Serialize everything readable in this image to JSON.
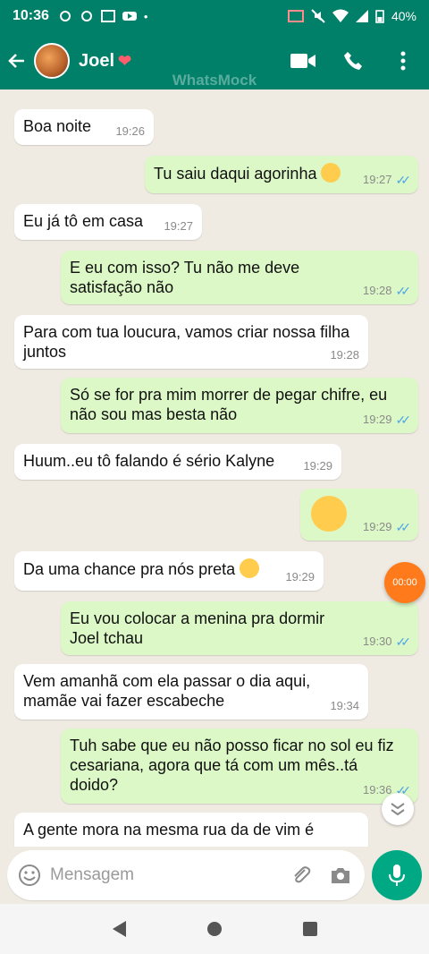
{
  "status_bar": {
    "time": "10:36",
    "battery": "40%"
  },
  "header": {
    "contact_name": "Joel",
    "watermark": "WhatsMock"
  },
  "messages": [
    {
      "dir": "in",
      "text": "Boa noite",
      "time": "19:26"
    },
    {
      "dir": "out",
      "text": "Tu saiu daqui agorinha",
      "time": "19:27"
    },
    {
      "dir": "in",
      "text": "Eu já tô em casa",
      "time": "19:27"
    },
    {
      "dir": "out",
      "text": "E eu com isso? Tu não me deve satisfação não",
      "time": "19:28"
    },
    {
      "dir": "in",
      "text": "Para com tua loucura, vamos criar nossa filha juntos",
      "time": "19:28"
    },
    {
      "dir": "out",
      "text": "Só se for pra mim morrer de pegar chifre, eu não sou mas besta não",
      "time": "19:29"
    },
    {
      "dir": "in",
      "text": "Huum..eu tô falando é sério Kalyne",
      "time": "19:29"
    },
    {
      "dir": "out",
      "text": "",
      "time": "19:29"
    },
    {
      "dir": "in",
      "text": "Da uma chance pra nós preta",
      "time": "19:29"
    },
    {
      "dir": "out",
      "text": "Eu vou colocar a menina pra dormir Joel tchau",
      "time": "19:30"
    },
    {
      "dir": "in",
      "text": "Vem amanhã com ela passar o dia aqui, mamãe vai fazer escabeche",
      "time": "19:34"
    },
    {
      "dir": "out",
      "text": "Tuh sabe que eu não posso ficar no sol eu fiz cesariana, agora que tá com um mês..tá doido?",
      "time": "19:36"
    },
    {
      "dir": "in",
      "text": "A gente mora na mesma rua da de vim é",
      "time": ""
    }
  ],
  "timer": "00:00",
  "composer": {
    "placeholder": "Mensagem"
  },
  "colors": {
    "header": "#008069",
    "outgoing": "#dcf8c6",
    "incoming": "#ffffff",
    "fab": "#00a884",
    "read_ticks": "#4fa6e8"
  }
}
